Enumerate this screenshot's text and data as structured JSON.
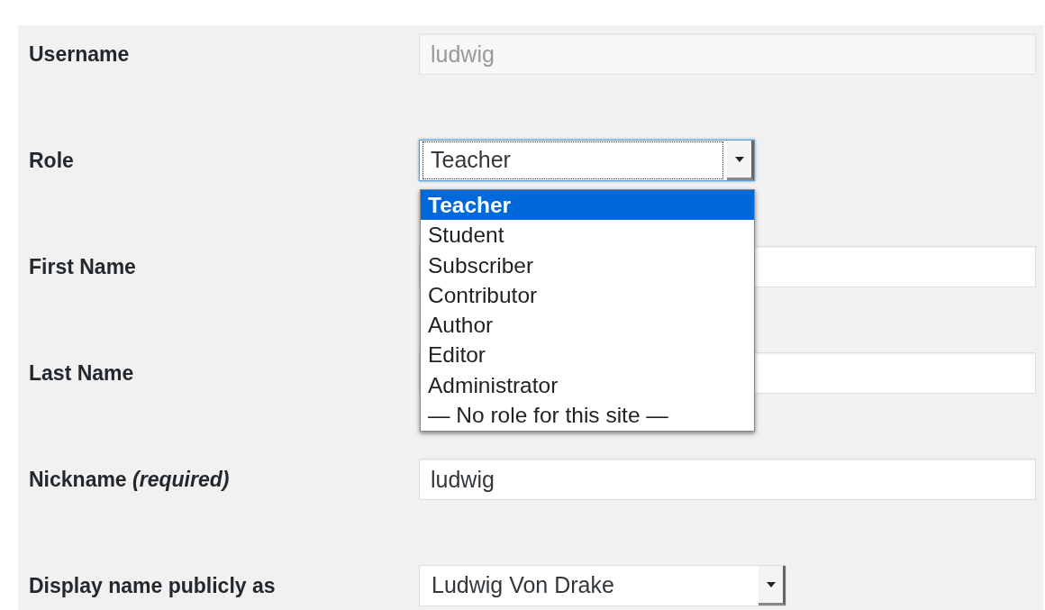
{
  "fields": [
    {
      "label": "Username",
      "kind": "text",
      "value": "ludwig",
      "disabled": true
    },
    {
      "label": "Role",
      "kind": "select",
      "value": "Teacher",
      "expanded": true,
      "options": [
        {
          "label": "Teacher",
          "selected": true
        },
        {
          "label": "Student",
          "selected": false
        },
        {
          "label": "Subscriber",
          "selected": false
        },
        {
          "label": "Contributor",
          "selected": false
        },
        {
          "label": "Author",
          "selected": false
        },
        {
          "label": "Editor",
          "selected": false
        },
        {
          "label": "Administrator",
          "selected": false
        },
        {
          "label": "— No role for this site —",
          "selected": false
        }
      ]
    },
    {
      "label": "First Name",
      "kind": "text",
      "disabled": false
    },
    {
      "label": "Last Name",
      "kind": "text",
      "disabled": false
    },
    {
      "label": "Nickname *(required)*",
      "kind": "text",
      "value": "ludwig",
      "disabled": false
    },
    {
      "label": "Display name publicly as",
      "kind": "select",
      "value": "Ludwig Von Drake",
      "expanded": false
    }
  ]
}
